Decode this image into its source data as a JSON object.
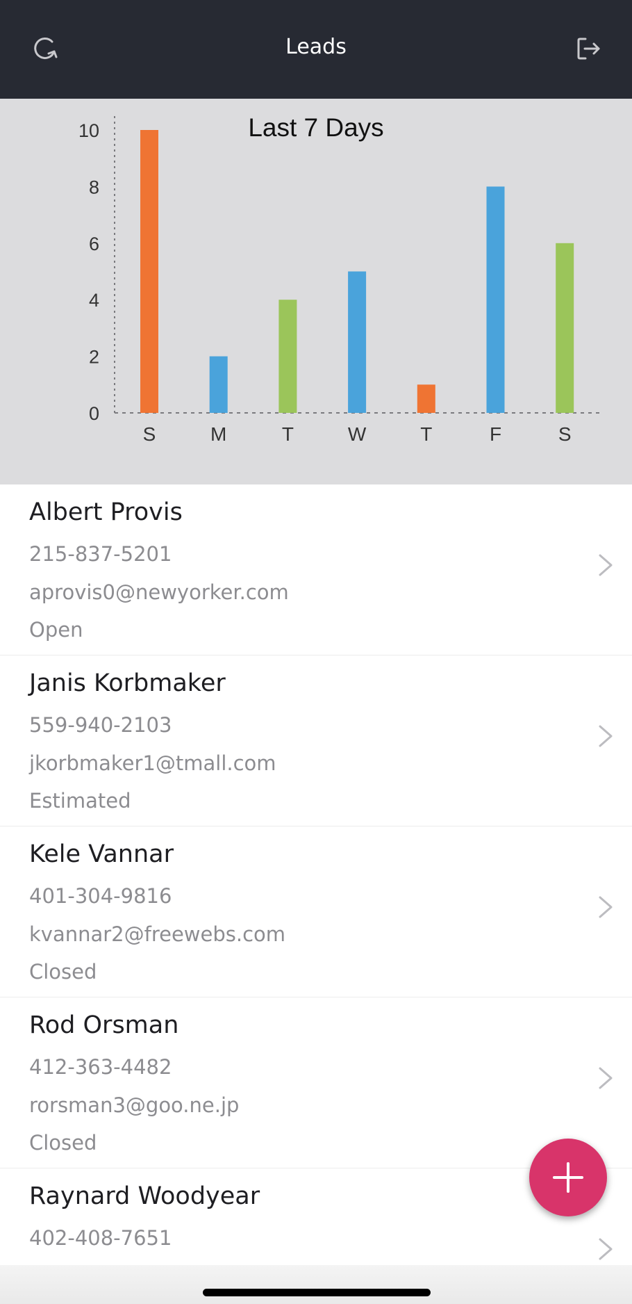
{
  "header": {
    "title": "Leads",
    "refresh_icon": "refresh-icon",
    "logout_icon": "logout-icon",
    "background": "#272a33"
  },
  "chart_data": {
    "type": "bar",
    "title": "Last 7 Days",
    "categories": [
      "S",
      "M",
      "T",
      "W",
      "T",
      "F",
      "S"
    ],
    "values": [
      10,
      2,
      4,
      5,
      1,
      8,
      6
    ],
    "colors": [
      "#ef7433",
      "#4aa3db",
      "#9bc55a",
      "#4aa3db",
      "#ef7433",
      "#4aa3db",
      "#9bc55a"
    ],
    "yticks": [
      "0",
      "2",
      "4",
      "6",
      "8",
      "10"
    ],
    "ylim": [
      0,
      10
    ],
    "xlabel": "",
    "ylabel": "",
    "grid": false,
    "axis_style": "dotted"
  },
  "leads": [
    {
      "name": "Albert Provis",
      "phone": "215-837-5201",
      "email": "aprovis0@newyorker.com",
      "status": "Open"
    },
    {
      "name": "Janis Korbmaker",
      "phone": "559-940-2103",
      "email": "jkorbmaker1@tmall.com",
      "status": "Estimated"
    },
    {
      "name": "Kele Vannar",
      "phone": "401-304-9816",
      "email": "kvannar2@freewebs.com",
      "status": "Closed"
    },
    {
      "name": "Rod Orsman",
      "phone": "412-363-4482",
      "email": "rorsman3@goo.ne.jp",
      "status": "Closed"
    },
    {
      "name": "Raynard Woodyear",
      "phone": "402-408-7651",
      "email": "",
      "status": ""
    }
  ],
  "fab": {
    "icon": "plus-icon",
    "color": "#d8346a"
  }
}
